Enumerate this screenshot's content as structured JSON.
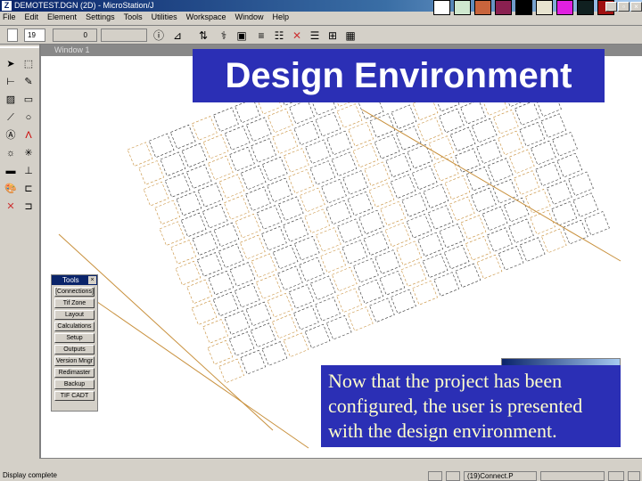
{
  "window": {
    "title": "DEMOTEST.DGN (2D) - MicroStation/J",
    "logo": "Z"
  },
  "menu": [
    "File",
    "Edit",
    "Element",
    "Settings",
    "Tools",
    "Utilities",
    "Workspace",
    "Window",
    "Help"
  ],
  "toolbar": {
    "level": "19",
    "weight": "0"
  },
  "view": {
    "title": "Window 1"
  },
  "headline": "Design Environment",
  "tools_dialog": {
    "title": "Tools",
    "buttons": [
      "[Connections]",
      "Tif Zone",
      "Layout",
      "Calculations",
      "Setup",
      "Outputs",
      "Version Mngr",
      "Redimaster",
      "Backup",
      "TIF CADT"
    ]
  },
  "status": {
    "message": "Display complete",
    "cell": "(19)Connect.P"
  },
  "callout": "Now that the project has been configured, the user is presented with the design environment.",
  "colors": {
    "accent": "#2b2fb5",
    "lines": "#c8903c"
  }
}
